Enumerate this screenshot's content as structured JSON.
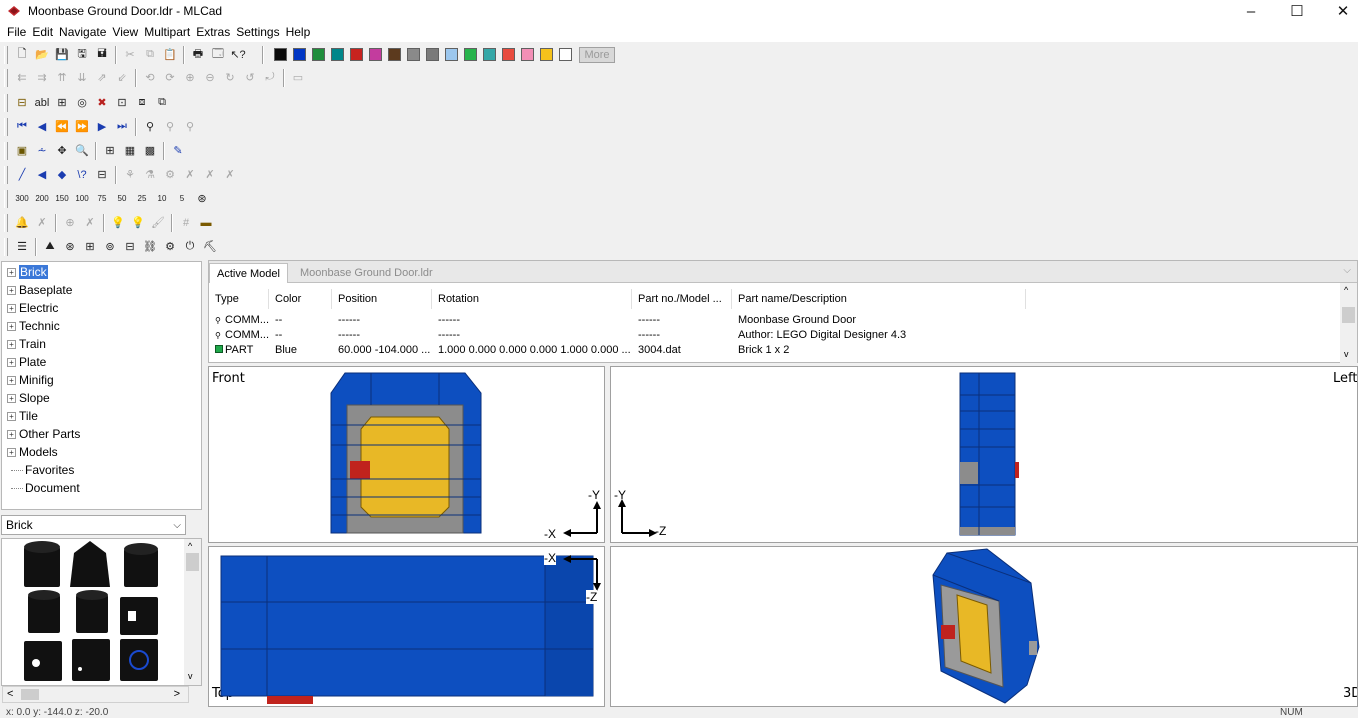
{
  "window": {
    "title": "Moonbase Ground Door.ldr - MLCad",
    "minimize": "–",
    "maximize": "☐",
    "close": "✕"
  },
  "menu": [
    "File",
    "Edit",
    "Navigate",
    "View",
    "Multipart",
    "Extras",
    "Settings",
    "Help"
  ],
  "palette": {
    "colors": [
      "#0a0a0a",
      "#0036c4",
      "#1f8d3b",
      "#00868a",
      "#c7231f",
      "#c33c9e",
      "#5c3a1e",
      "#8a8a8a",
      "#7a7a7a",
      "#9cc7ee",
      "#27b34b",
      "#35a7a7",
      "#e84b3e",
      "#f38fb6",
      "#f5c21b",
      "#ffffff"
    ],
    "more_label": "More"
  },
  "tree": {
    "items": [
      {
        "label": "Brick",
        "expandable": true,
        "selected": true
      },
      {
        "label": "Baseplate",
        "expandable": true
      },
      {
        "label": "Electric",
        "expandable": true
      },
      {
        "label": "Technic",
        "expandable": true
      },
      {
        "label": "Train",
        "expandable": true
      },
      {
        "label": "Plate",
        "expandable": true
      },
      {
        "label": "Minifig",
        "expandable": true
      },
      {
        "label": "Slope",
        "expandable": true
      },
      {
        "label": "Tile",
        "expandable": true
      },
      {
        "label": "Other Parts",
        "expandable": true
      },
      {
        "label": "Models",
        "expandable": true
      },
      {
        "label": "Favorites",
        "expandable": false
      },
      {
        "label": "Document",
        "expandable": false
      }
    ]
  },
  "part_selector": {
    "value": "Brick"
  },
  "model_panel": {
    "tabs": [
      "Active Model",
      "Moonbase Ground Door.ldr"
    ],
    "columns": [
      "Type",
      "Color",
      "Position",
      "Rotation",
      "Part no./Model ...",
      "Part name/Description"
    ],
    "rows": [
      {
        "type": "COMM...",
        "color": "--",
        "position": "------",
        "rotation": "------",
        "part_no": "------",
        "desc": "Moonbase Ground Door"
      },
      {
        "type": "COMM...",
        "color": "--",
        "position": "------",
        "rotation": "------",
        "part_no": "------",
        "desc": "Author: LEGO Digital Designer 4.3"
      },
      {
        "type": "PART",
        "color": "Blue",
        "position": "60.000 -104.000 ...",
        "rotation": "1.000 0.000 0.000 0.000 1.000 0.000 ...",
        "part_no": "3004.dat",
        "desc": "Brick  1 x  2"
      }
    ]
  },
  "viewports": {
    "front": "Front",
    "left": "Left",
    "top": "Top",
    "three_d": "3D",
    "axes": {
      "neg_x": "-X",
      "neg_y": "-Y",
      "neg_z": "-Z"
    }
  },
  "status": {
    "coords": "x: 0.0  y: -144.0  z: -20.0",
    "num": "NUM"
  }
}
